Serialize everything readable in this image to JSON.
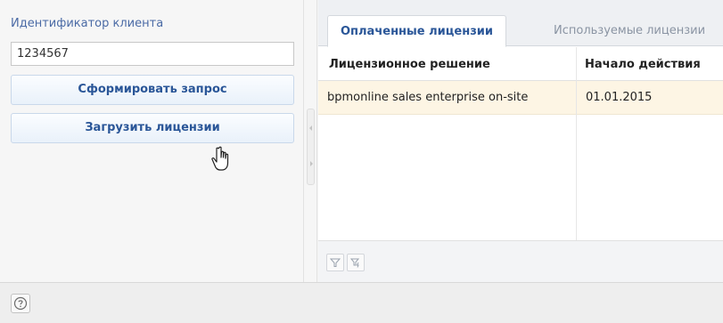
{
  "left_panel": {
    "client_id_label": "Идентификатор клиента",
    "client_id_value": "1234567",
    "request_button_label": "Сформировать запрос",
    "upload_button_label": "Загрузить лицензии"
  },
  "tabs": [
    {
      "label": "Оплаченные лицензии",
      "active": true
    },
    {
      "label": "Используемые лицензии",
      "active": false
    }
  ],
  "grid": {
    "columns": [
      "Лицензионное решение",
      "Начало действия"
    ],
    "rows": [
      [
        "bpmonline sales enterprise on-site",
        "01.01.2015"
      ]
    ]
  },
  "colors": {
    "accent": "#2a5698",
    "selected_row": "#fdf5e4"
  },
  "icons": {
    "filter": "filter-icon",
    "filter_secondary": "filter-lightning-icon",
    "help": "help-icon",
    "cursor": "hand-cursor-icon"
  }
}
